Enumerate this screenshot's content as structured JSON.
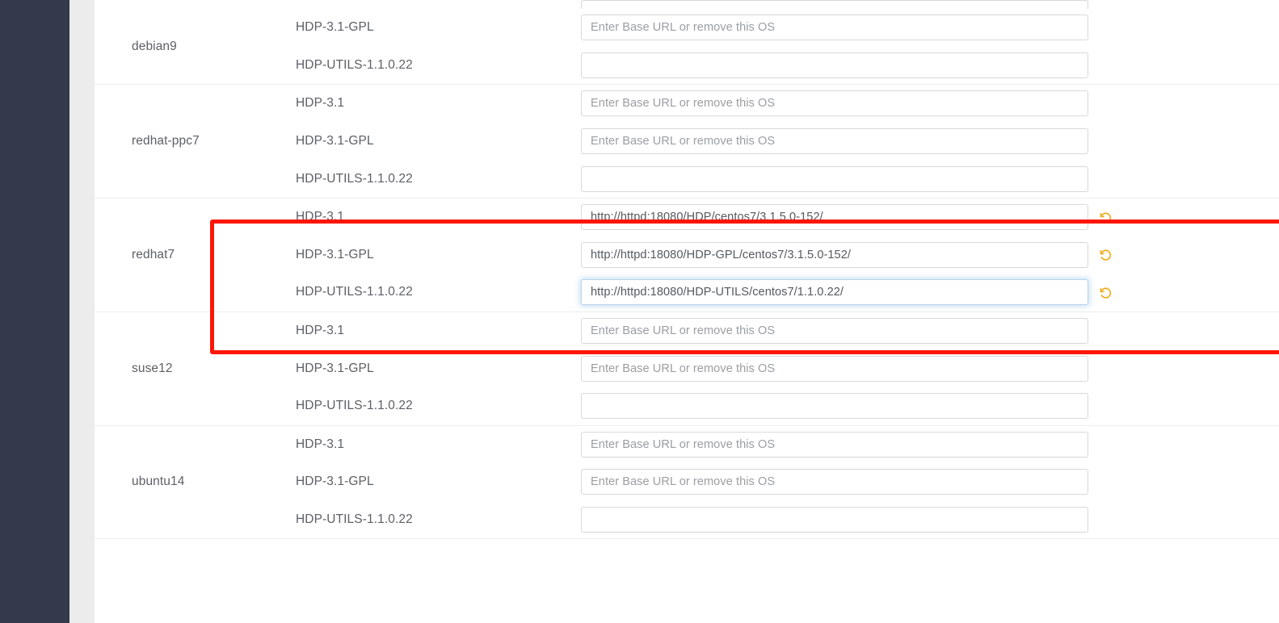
{
  "app": {
    "sidebar_color": "#343a4c",
    "gutter_color": "#ececec",
    "content_background": "#ffffff",
    "accent_revert_color": "#f0ad21",
    "highlight_color": "#fd1607",
    "focus_glow_color": "#b8d4ea"
  },
  "placeholders": {
    "base_url": "Enter Base URL or remove this OS",
    "empty": ""
  },
  "icons": {
    "revert": "revert-icon"
  },
  "repositories": {
    "groups": [
      {
        "os": "debian9",
        "partial_top_row": true,
        "rows": [
          {
            "stack": "HDP-3.1-GPL",
            "value": "",
            "placeholder": "Enter Base URL or remove this OS",
            "focused": false,
            "has_revert": false
          },
          {
            "stack": "HDP-UTILS-1.1.0.22",
            "value": "",
            "placeholder": "",
            "focused": false,
            "has_revert": false
          }
        ]
      },
      {
        "os": "redhat-ppc7",
        "partial_top_row": false,
        "rows": [
          {
            "stack": "HDP-3.1",
            "value": "",
            "placeholder": "Enter Base URL or remove this OS",
            "focused": false,
            "has_revert": false
          },
          {
            "stack": "HDP-3.1-GPL",
            "value": "",
            "placeholder": "Enter Base URL or remove this OS",
            "focused": false,
            "has_revert": false
          },
          {
            "stack": "HDP-UTILS-1.1.0.22",
            "value": "",
            "placeholder": "",
            "focused": false,
            "has_revert": false
          }
        ]
      },
      {
        "os": "redhat7",
        "partial_top_row": false,
        "highlighted": true,
        "rows": [
          {
            "stack": "HDP-3.1",
            "value": "http://httpd:18080/HDP/centos7/3.1.5.0-152/",
            "placeholder": "Enter Base URL or remove this OS",
            "focused": false,
            "has_revert": true
          },
          {
            "stack": "HDP-3.1-GPL",
            "value": "http://httpd:18080/HDP-GPL/centos7/3.1.5.0-152/",
            "placeholder": "Enter Base URL or remove this OS",
            "focused": false,
            "has_revert": true
          },
          {
            "stack": "HDP-UTILS-1.1.0.22",
            "value": "http://httpd:18080/HDP-UTILS/centos7/1.1.0.22/",
            "placeholder": "",
            "focused": true,
            "has_revert": true
          }
        ]
      },
      {
        "os": "suse12",
        "partial_top_row": false,
        "rows": [
          {
            "stack": "HDP-3.1",
            "value": "",
            "placeholder": "Enter Base URL or remove this OS",
            "focused": false,
            "has_revert": false
          },
          {
            "stack": "HDP-3.1-GPL",
            "value": "",
            "placeholder": "Enter Base URL or remove this OS",
            "focused": false,
            "has_revert": false
          },
          {
            "stack": "HDP-UTILS-1.1.0.22",
            "value": "",
            "placeholder": "",
            "focused": false,
            "has_revert": false
          }
        ]
      },
      {
        "os": "ubuntu14",
        "partial_top_row": false,
        "rows": [
          {
            "stack": "HDP-3.1",
            "value": "",
            "placeholder": "Enter Base URL or remove this OS",
            "focused": false,
            "has_revert": false
          },
          {
            "stack": "HDP-3.1-GPL",
            "value": "",
            "placeholder": "Enter Base URL or remove this OS",
            "focused": false,
            "has_revert": false
          },
          {
            "stack": "HDP-UTILS-1.1.0.22",
            "value": "",
            "placeholder": "",
            "focused": false,
            "has_revert": false
          }
        ]
      }
    ]
  }
}
